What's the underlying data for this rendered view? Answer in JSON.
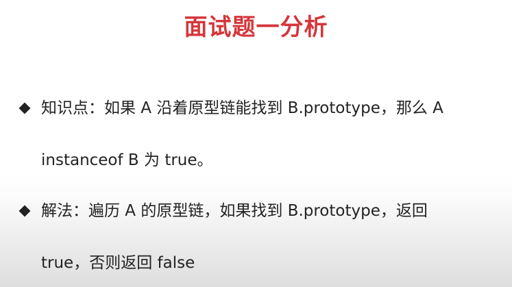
{
  "theme": {
    "title_color": "#d5363a",
    "text_color": "#222222"
  },
  "slide": {
    "title": "面试题一分析",
    "bullets": [
      {
        "icon": "diamond-bullet-icon",
        "lines": [
          "知识点：如果 A 沿着原型链能找到 B.prototype，那么 A",
          "instanceof B 为 true。"
        ]
      },
      {
        "icon": "diamond-bullet-icon",
        "lines": [
          "解法：遍历 A 的原型链，如果找到 B.prototype，返回",
          "true，否则返回 false"
        ]
      }
    ]
  }
}
